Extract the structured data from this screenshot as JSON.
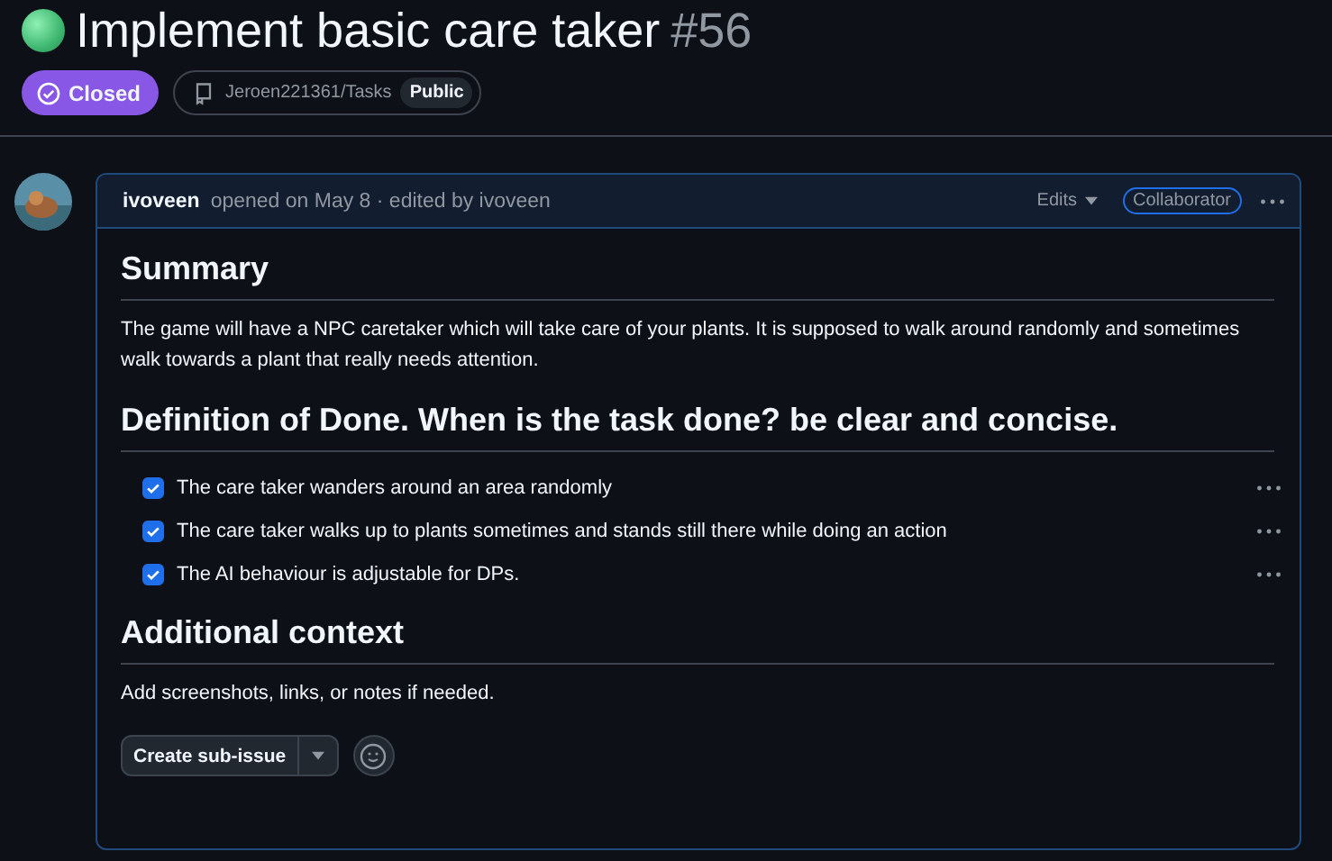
{
  "issue": {
    "title": "Implement basic care taker",
    "number": "#56",
    "state": "Closed",
    "repo": "Jeroen221361/Tasks",
    "visibility": "Public"
  },
  "comment": {
    "author": "ivoveen",
    "meta": "opened on May 8 · edited by ivoveen",
    "edits": "Edits",
    "role": "Collaborator",
    "blocks": [
      {
        "kind": "heading",
        "text": "Summary"
      },
      {
        "kind": "paragraph",
        "text": "The game will have a NPC caretaker which will take care of your plants. It is supposed to walk around randomly and sometimes walk towards a plant that really needs attention."
      },
      {
        "kind": "heading",
        "text": "Definition of Done. When is the task done? be clear and concise."
      },
      {
        "kind": "tasklist",
        "items": [
          {
            "text": "The care taker wanders around an area randomly",
            "checked": true
          },
          {
            "text": "The care taker walks up to plants sometimes and stands still there while doing an action",
            "checked": true
          },
          {
            "text": "The AI behaviour is adjustable for DPs.",
            "checked": true
          }
        ]
      },
      {
        "kind": "heading",
        "text": "Additional context"
      },
      {
        "kind": "paragraph",
        "text": "Add screenshots, links, or notes if needed."
      }
    ],
    "action": "Create sub-issue"
  }
}
